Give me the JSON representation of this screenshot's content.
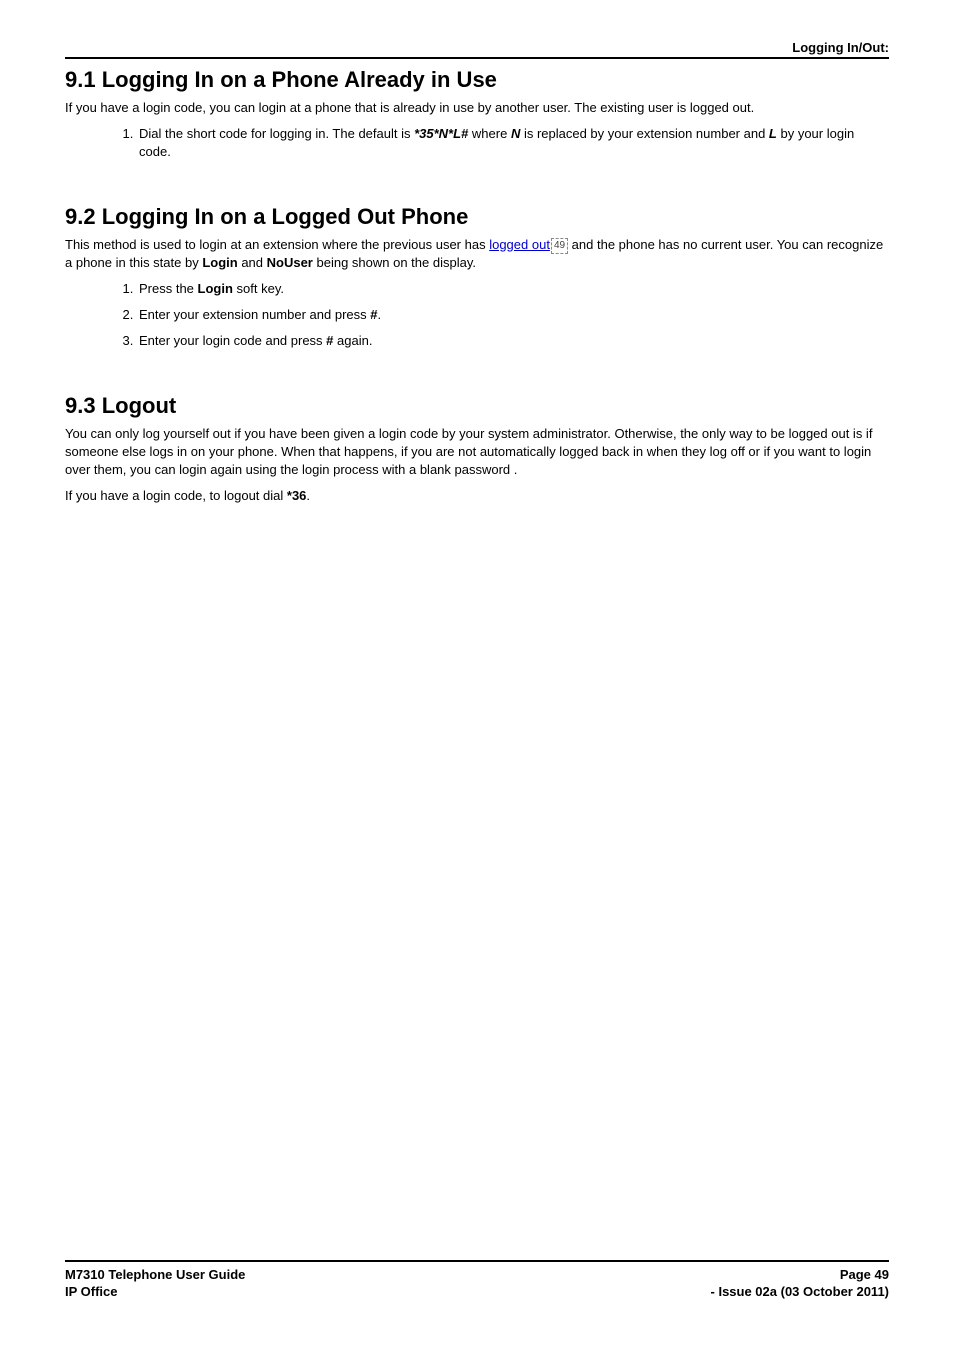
{
  "header": {
    "breadcrumb": "Logging In/Out:"
  },
  "section91": {
    "heading": "9.1 Logging In on a Phone Already in Use",
    "intro": "If you have a login code, you can login at a phone that is already in use by another user. The existing user is logged out.",
    "step1_a": "Dial the short code for logging in. The default is ",
    "step1_code": "*35*N*L#",
    "step1_b": " where ",
    "step1_N": "N",
    "step1_c": " is replaced by your extension number and ",
    "step1_L": "L",
    "step1_d": " by your login code."
  },
  "section92": {
    "heading": "9.2 Logging In on a Logged Out Phone",
    "intro_a": "This method is used to login at an extension where the previous user has ",
    "intro_link": "logged out",
    "intro_ref": "49",
    "intro_b": " and the phone has no current user. You can recognize a phone in this state by ",
    "intro_bold1": "Login",
    "intro_c": " and ",
    "intro_bold2": "NoUser",
    "intro_d": " being shown on the display.",
    "step1_a": "Press the ",
    "step1_bold": "Login",
    "step1_b": " soft key.",
    "step2_a": "Enter your extension number and press ",
    "step2_bold": "#",
    "step2_b": ".",
    "step3_a": "Enter your login code and press ",
    "step3_bold": "#",
    "step3_b": " again."
  },
  "section93": {
    "heading": "9.3 Logout",
    "para1": "You can only log yourself out if you have been given a login code by your system administrator. Otherwise, the only way to be logged out is if someone else logs in on your phone. When that happens, if you are not automatically logged back in when they log off or if you want to login over them, you can login again using the login process with a blank password .",
    "para2_a": "If you have a login code, to logout dial ",
    "para2_bold": "*36",
    "para2_b": "."
  },
  "footer": {
    "left1": "M7310 Telephone User Guide",
    "right1": "Page 49",
    "left2": "IP Office",
    "right2": "- Issue 02a (03 October 2011)"
  }
}
